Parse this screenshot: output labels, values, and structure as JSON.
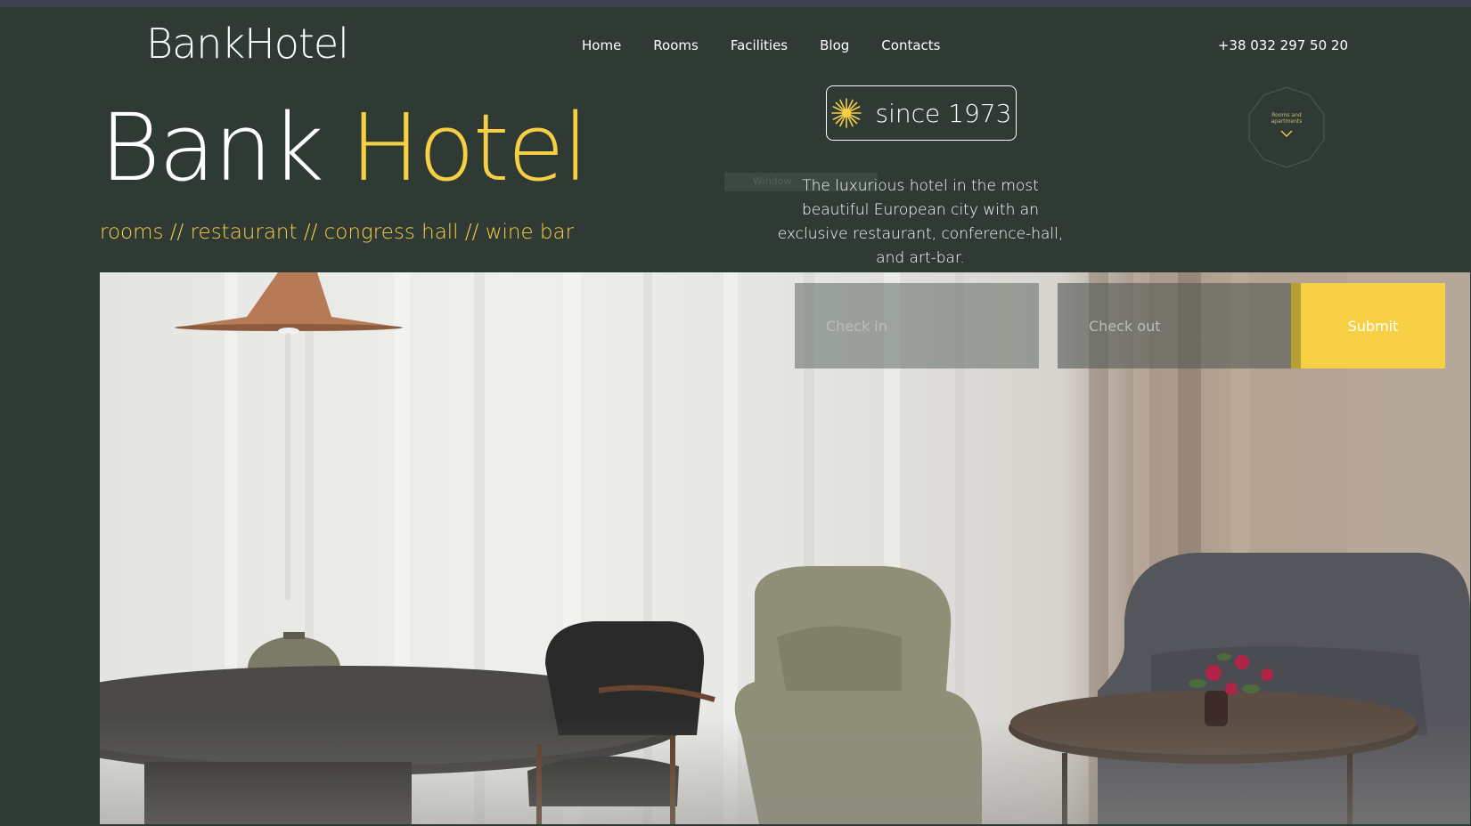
{
  "header": {
    "logo": "BankHotel",
    "nav": [
      {
        "label": "Home"
      },
      {
        "label": "Rooms"
      },
      {
        "label": "Facilities"
      },
      {
        "label": "Blog"
      },
      {
        "label": "Contacts"
      }
    ],
    "phone": "+38 032 297 50 20"
  },
  "hero": {
    "title_part1": "Bank",
    "title_part2": "Hotel",
    "tagline": "rooms // restaurant // congress hall // wine bar",
    "since": "since 1973",
    "description": "The luxurious hotel in the most beautiful European city with an exclusive restaurant, conference-hall, and art-bar.",
    "badge": "Rooms and apartments",
    "ghost_label": "Window"
  },
  "booking": {
    "checkin_placeholder": "Check in",
    "checkout_placeholder": "Check out",
    "submit_label": "Submit"
  },
  "colors": {
    "background": "#2e3a33",
    "accent": "#f7cf45",
    "text": "#ffffff"
  },
  "icons": {
    "star": "star-icon",
    "chevron": "chevron-down-icon"
  }
}
